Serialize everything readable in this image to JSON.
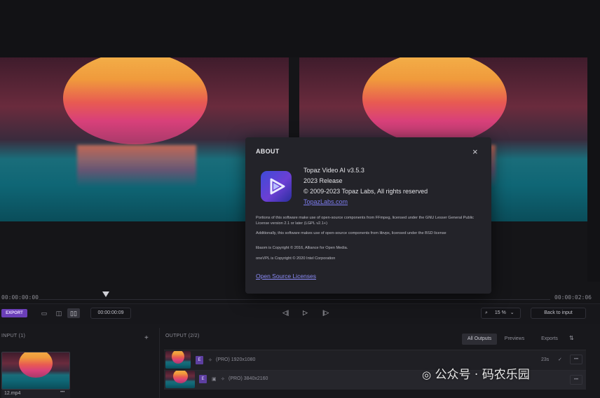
{
  "timeline": {
    "start": "00:00:00:00",
    "end": "00:00:02:06"
  },
  "controls": {
    "export_label": "EXPORT",
    "timecode": "00:00:00:09",
    "zoom_value": "15 %",
    "back_to_input": "Back to input"
  },
  "input_panel": {
    "title": "INPUT (1)",
    "add": "+",
    "file_name": "12.mp4",
    "more": "•••"
  },
  "output_panel": {
    "title": "OUTPUT (2/2)",
    "tabs": [
      "All Outputs",
      "Previews",
      "Exports"
    ],
    "rows": [
      {
        "badge": "E",
        "desc": "(PRO)  1920x1080",
        "time": "23s",
        "more": "•••"
      },
      {
        "badge": "E",
        "desc": "(PRO)  3840x2160",
        "time": "",
        "more": "•••"
      }
    ]
  },
  "about": {
    "title": "ABOUT",
    "close": "×",
    "product": "Topaz Video AI  v3.5.3",
    "release": "2023 Release",
    "copyright": "© 2009-2023 Topaz Labs, All rights reserved",
    "website": "TopazLabs.com",
    "notice1": "Portions of this software make use of open-source components from FFmpeg, licensed under the GNU Lesser General Public License version 2.1 or later (LGPL v2.1+)",
    "notice2": "Additionally, this software makes use of open-source components from libvpx, licensed under the BSD license",
    "notice3": "libaom is Copyright © 2016, Alliance for Open Media.",
    "notice4": "oneVPL is Copyright © 2020 Intel Corporation",
    "licenses_link": "Open Source Licenses"
  },
  "watermark": "公众号 · 码农乐园",
  "colors": {
    "accent": "#6b3fb8",
    "link": "#7d7df0",
    "dialog_bg": "#232329"
  }
}
